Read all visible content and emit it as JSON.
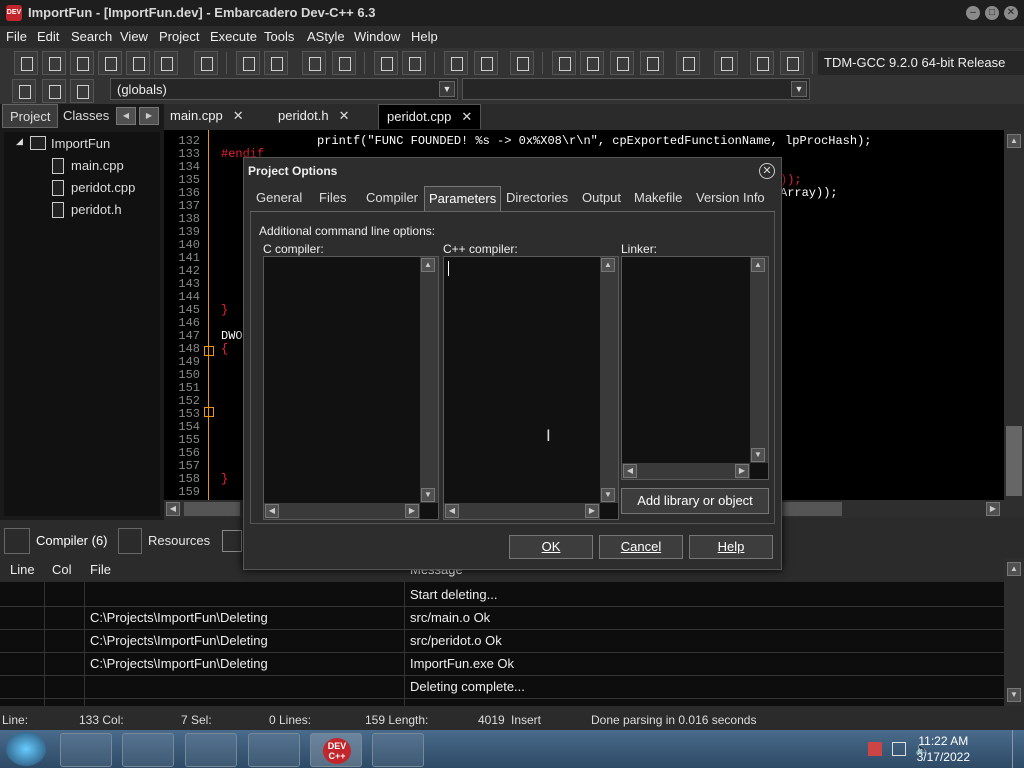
{
  "window": {
    "title": "ImportFun - [ImportFun.dev] - Embarcadero Dev-C++ 6.3"
  },
  "menu": [
    "File",
    "Edit",
    "Search",
    "View",
    "Project",
    "Execute",
    "Tools",
    "AStyle",
    "Window",
    "Help"
  ],
  "toolbar": {
    "compiler": "TDM-GCC 9.2.0 64-bit Release",
    "scope": "(globals)"
  },
  "left_panel": {
    "tabs": [
      "Project",
      "Classes"
    ],
    "tree": {
      "root": "ImportFun",
      "files": [
        "main.cpp",
        "peridot.cpp",
        "peridot.h"
      ]
    }
  },
  "editor": {
    "tabs": [
      "main.cpp",
      "peridot.h",
      "peridot.cpp"
    ],
    "line_numbers": [
      "132",
      "133",
      "134",
      "135",
      "136",
      "137",
      "138",
      "139",
      "140",
      "141",
      "142",
      "143",
      "144",
      "145",
      "146",
      "147",
      "148",
      "149",
      "150",
      "151",
      "152",
      "153",
      "154",
      "155",
      "156",
      "157",
      "158",
      "159"
    ],
    "line132": "printf(\"FUNC FOUNDED! %s -> 0x%X08\\r\\n\", cpExportedFunctionName, lpProcHash);",
    "line133": "#endif",
    "frag135": "));",
    "frag136": "Array));",
    "frag145": "}",
    "frag147": "DWO",
    "frag148": "{",
    "frag158": "}"
  },
  "dialog": {
    "title": "Project Options",
    "tabs": [
      "General",
      "Files",
      "Compiler",
      "Parameters",
      "Directories",
      "Output",
      "Makefile",
      "Version Info"
    ],
    "active_tab": "Parameters",
    "heading": "Additional command line options:",
    "c_label": "C compiler:",
    "cpp_label": "C++ compiler:",
    "linker_label": "Linker:",
    "add_library": "Add library or object",
    "ok": "OK",
    "cancel": "Cancel",
    "help": "Help"
  },
  "bottom": {
    "tabs": [
      "Compiler (6)",
      "Resources"
    ],
    "columns": [
      "Line",
      "Col",
      "File",
      "Message"
    ],
    "rows": [
      {
        "file": "",
        "message": "Start deleting..."
      },
      {
        "file": "C:\\Projects\\ImportFun\\Deleting",
        "message": "src/main.o Ok"
      },
      {
        "file": "C:\\Projects\\ImportFun\\Deleting",
        "message": "src/peridot.o Ok"
      },
      {
        "file": "C:\\Projects\\ImportFun\\Deleting",
        "message": "ImportFun.exe Ok"
      },
      {
        "file": "",
        "message": "Deleting complete..."
      }
    ]
  },
  "status": {
    "line": "Line:",
    "line_val": "133 Col:",
    "col_val": "7 Sel:",
    "sel_val": "0 Lines:",
    "lines_val": "159 Length:",
    "length_val": "4019",
    "mode": "Insert",
    "message": "Done parsing in 0.016 seconds"
  },
  "taskbar": {
    "time": "11:22 AM",
    "date": "3/17/2022",
    "devcpp_label": "DEV C++"
  }
}
